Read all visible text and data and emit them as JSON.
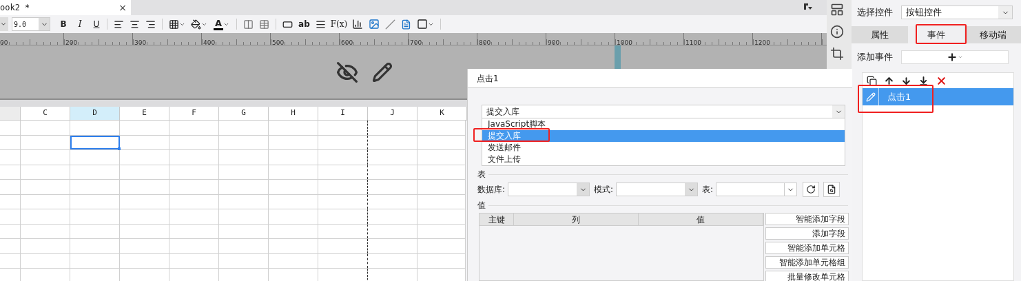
{
  "document_tab": {
    "title": "ook2 *",
    "close": "×"
  },
  "toolbar": {
    "font_size": "9.0",
    "format_buttons": [
      "B",
      "I",
      "U"
    ],
    "font_color_label": "A",
    "text_widget_label": "ab",
    "formula_label": "F(x)"
  },
  "ruler": {
    "labels": [
      "00",
      "200",
      "300",
      "400",
      "500",
      "600",
      "700",
      "800",
      "900",
      "1000",
      "1100",
      "1200"
    ]
  },
  "columns": [
    {
      "label": "C",
      "selected": false
    },
    {
      "label": "D",
      "selected": true
    },
    {
      "label": "E",
      "selected": false
    },
    {
      "label": "F",
      "selected": false
    },
    {
      "label": "G",
      "selected": false
    },
    {
      "label": "H",
      "selected": false
    },
    {
      "label": "I",
      "selected": false
    },
    {
      "label": "J",
      "selected": false
    },
    {
      "label": "K",
      "selected": false
    }
  ],
  "rows": [
    {
      "selected": false
    },
    {
      "selected": true
    },
    {
      "selected": false
    },
    {
      "selected": false
    },
    {
      "selected": false
    },
    {
      "selected": false
    },
    {
      "selected": false
    },
    {
      "selected": false
    },
    {
      "selected": false
    },
    {
      "selected": false
    },
    {
      "selected": false
    }
  ],
  "dialog": {
    "title": "点击1",
    "action_select": {
      "value": "提交入库",
      "options": [
        {
          "label": "JavaScript脚本",
          "selected": false
        },
        {
          "label": "提交入库",
          "selected": true
        },
        {
          "label": "发送邮件",
          "selected": false
        },
        {
          "label": "文件上传",
          "selected": false
        }
      ]
    },
    "table_section": {
      "label": "表",
      "fields": [
        {
          "label": "数据库:"
        },
        {
          "label": "模式:"
        },
        {
          "label": "表:"
        }
      ]
    },
    "value_section": {
      "label": "值",
      "columns": [
        "主键",
        "列",
        "值"
      ],
      "buttons": [
        "智能添加字段",
        "添加字段",
        "智能添加单元格",
        "智能添加单元格组",
        "批量修改单元格"
      ]
    }
  },
  "right_panel": {
    "select_label": "选择控件",
    "select_value": "按钮控件",
    "tabs": [
      {
        "label": "属性",
        "selected": false
      },
      {
        "label": "事件",
        "selected": true
      },
      {
        "label": "移动端",
        "selected": false
      }
    ],
    "add_event_label": "添加事件",
    "events": [
      {
        "label": "点击1",
        "selected": true
      }
    ]
  }
}
